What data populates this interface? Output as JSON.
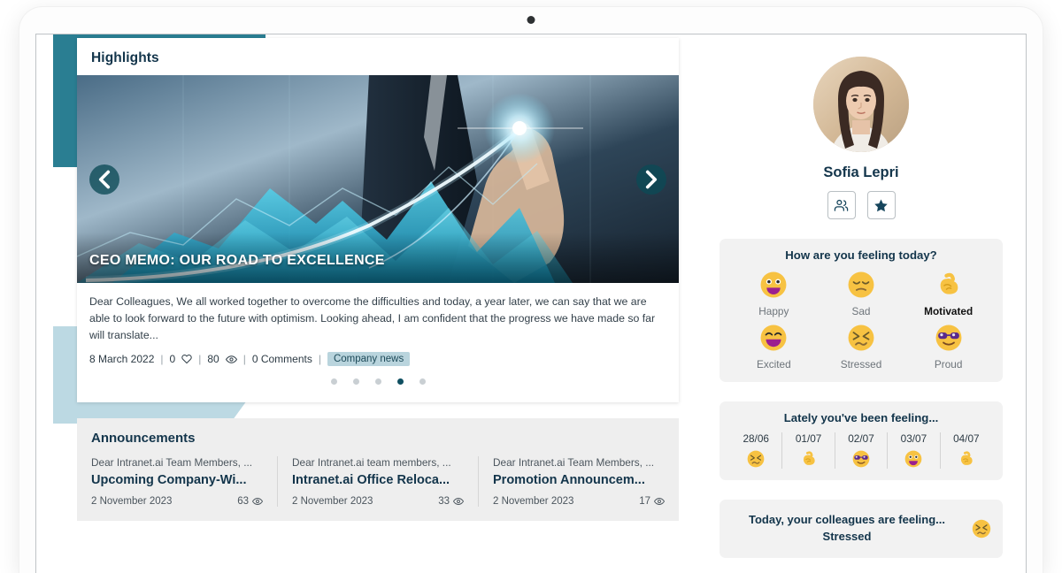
{
  "device": {
    "camera_icon": "camera-dot"
  },
  "highlights": {
    "header": "Highlights",
    "hero_title": "CEO MEMO: OUR ROAD TO EXCELLENCE",
    "prev_icon": "chevron-left-icon",
    "next_icon": "chevron-right-icon",
    "excerpt": "Dear Colleagues, We all worked together to overcome the difficulties and today, a year later, we can say that we are able to look forward to the future with optimism. Looking ahead, I am confident that the progress we have made so far will translate...",
    "meta": {
      "date": "8 March 2022",
      "likes": "0",
      "like_icon": "heart-icon",
      "views": "80",
      "views_icon": "eye-icon",
      "comments": "0 Comments",
      "tag": "Company news",
      "separator": "|"
    },
    "carousel": {
      "total_dots": 5,
      "active_index": 3
    }
  },
  "announcements": {
    "header": "Announcements",
    "items": [
      {
        "preview": "Dear Intranet.ai Team Members, ...",
        "title": "Upcoming Company-Wi...",
        "date": "2 November 2023",
        "views": "63",
        "views_icon": "eye-icon"
      },
      {
        "preview": "Dear Intranet.ai team members, ...",
        "title": "Intranet.ai Office Reloca...",
        "date": "2 November 2023",
        "views": "33",
        "views_icon": "eye-icon"
      },
      {
        "preview": "Dear Intranet.ai Team Members, ...",
        "title": "Promotion Announcem...",
        "date": "2 November 2023",
        "views": "17",
        "views_icon": "eye-icon"
      }
    ]
  },
  "profile": {
    "name": "Sofia Lepri",
    "avatar_icon": "user-avatar-photo",
    "actions": [
      {
        "icon": "people-icon",
        "name": "colleagues-button"
      },
      {
        "icon": "star-icon",
        "name": "favorite-button"
      }
    ]
  },
  "mood_picker": {
    "title": "How are you feeling today?",
    "options": [
      {
        "label": "Happy",
        "icon": "grinning-face-icon",
        "selected": false
      },
      {
        "label": "Sad",
        "icon": "pensive-face-icon",
        "selected": false
      },
      {
        "label": "Motivated",
        "icon": "flexed-biceps-icon",
        "selected": true
      },
      {
        "label": "Excited",
        "icon": "beaming-face-icon",
        "selected": false
      },
      {
        "label": "Stressed",
        "icon": "confounded-face-icon",
        "selected": false
      },
      {
        "label": "Proud",
        "icon": "sunglasses-face-icon",
        "selected": false
      }
    ]
  },
  "mood_history": {
    "title": "Lately you've been feeling...",
    "entries": [
      {
        "date": "28/06",
        "icon": "confounded-face-icon",
        "mood": "Stressed"
      },
      {
        "date": "01/07",
        "icon": "flexed-biceps-icon",
        "mood": "Motivated"
      },
      {
        "date": "02/07",
        "icon": "sunglasses-face-icon",
        "mood": "Proud"
      },
      {
        "date": "03/07",
        "icon": "grinning-face-icon",
        "mood": "Happy"
      },
      {
        "date": "04/07",
        "icon": "flexed-biceps-icon",
        "mood": "Motivated"
      }
    ]
  },
  "colleagues_mood": {
    "line1": "Today, your colleagues are feeling...",
    "line2": "Stressed",
    "icon": "confounded-face-icon"
  },
  "colors": {
    "brand_teal": "#2a7e92",
    "brand_light_blue": "#bcd9e3",
    "heading_navy": "#13354b",
    "tag_bg": "#b9d4dd",
    "dot_active": "#0f4f61",
    "emoji_yellow": "#f7c242",
    "emoji_mouth": "#9b1f8f"
  }
}
